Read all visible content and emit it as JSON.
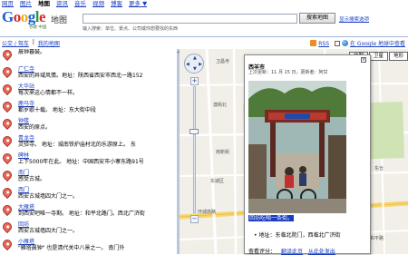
{
  "topnav": [
    {
      "label": "网页",
      "active": false
    },
    {
      "label": "图片",
      "active": false
    },
    {
      "label": "地图",
      "active": true
    },
    {
      "label": "资讯",
      "active": false
    },
    {
      "label": "音乐",
      "active": false
    },
    {
      "label": "视频",
      "active": false
    },
    {
      "label": "博客",
      "active": false
    },
    {
      "label": "更多 ▼",
      "active": false
    }
  ],
  "logo": {
    "text_sub": "谷歌 中国",
    "product": "地图"
  },
  "search": {
    "value": "",
    "button": "搜索地图",
    "options": "显示搜索选项",
    "hint": "输入搜索：单位、景点、公司或你想要找的东西"
  },
  "tabs": {
    "links": [
      "公交 / 驾车",
      "我的地图"
    ],
    "separator": "|"
  },
  "toolbar": {
    "rss": "RSS",
    "earth": "在 Google 地球中查看"
  },
  "results": [
    {
      "title": "",
      "desc": "晨钟暮鼓。"
    },
    {
      "title": "广仁寺",
      "desc": "西安的异域风情。地址：陕西省西安市西北一路152"
    },
    {
      "title": "大华站",
      "desc": "每次来这心情都不一样。"
    },
    {
      "title": "鹿马寺",
      "desc": "都岁歌十载。   地址：东大街中段"
    },
    {
      "title": "钟楼",
      "desc": "西安的原点。"
    },
    {
      "title": "青龙寺",
      "desc": "灵验寺。   地址：城南铁炉庙村北的乐游原上。   东"
    },
    {
      "title": "碑林",
      "desc": "上下5000年在此。   地址：中国西安市小寨东路91号"
    },
    {
      "title": "南门",
      "desc": "感受古城。"
    },
    {
      "title": "西门",
      "desc": "西安古城墙四大门之一。"
    },
    {
      "title": "大雁塔",
      "desc": "到西安吧唯一寺剩。   地址：和平北路门。西北广济街"
    },
    {
      "title": "回坊",
      "desc": "西安古城墙四大门之一。"
    },
    {
      "title": "小雁塔",
      "desc": "\"雁塔晨钟\" 也是清代关中八景之一。   南门外"
    }
  ],
  "map": {
    "type_buttons": [
      "地图",
      "卫星",
      "地形"
    ],
    "labels": [
      {
        "text": "卫昌寺"
      },
      {
        "text": "澳街北"
      },
      {
        "text": "南新街"
      },
      {
        "text": "东城区"
      },
      {
        "text": "环城南路"
      },
      {
        "text": "东仓"
      },
      {
        "text": "和平路"
      }
    ]
  },
  "info": {
    "title": "西羊市",
    "meta": "上次更新：11 月 15 日，更新者：阿甘",
    "caption": "回坊吃喝一条街。",
    "address": "地址：东临北院门，西临北广济街",
    "rating_label": "查看评分：",
    "rating_links": [
      "翻译此页",
      "从此处发出"
    ]
  }
}
